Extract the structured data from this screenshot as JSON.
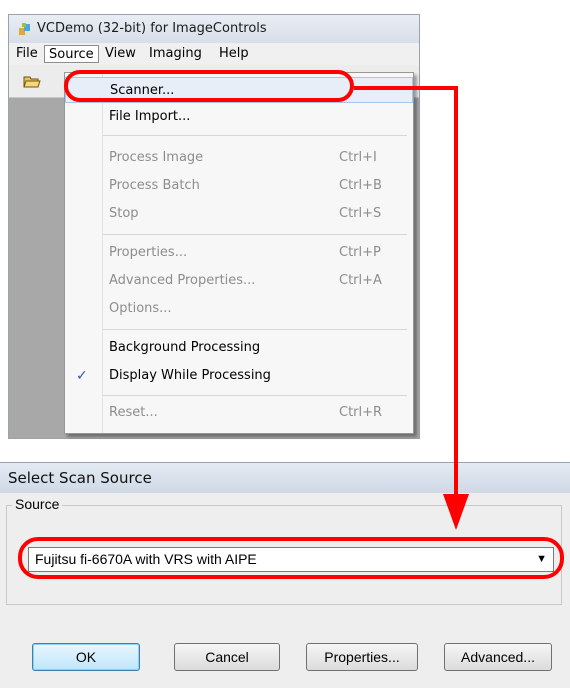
{
  "app": {
    "title": "VCDemo (32-bit) for ImageControls",
    "menus": [
      "File",
      "Source",
      "View",
      "Imaging",
      "Help"
    ]
  },
  "source_menu": {
    "items": [
      {
        "label": "Scanner...",
        "shortcut": "",
        "enabled": true
      },
      {
        "label": "File Import...",
        "shortcut": "",
        "enabled": true
      },
      {
        "label": "Process Image",
        "shortcut": "Ctrl+I",
        "enabled": false
      },
      {
        "label": "Process Batch",
        "shortcut": "Ctrl+B",
        "enabled": false
      },
      {
        "label": "Stop",
        "shortcut": "Ctrl+S",
        "enabled": false
      },
      {
        "label": "Properties...",
        "shortcut": "Ctrl+P",
        "enabled": false
      },
      {
        "label": "Advanced Properties...",
        "shortcut": "Ctrl+A",
        "enabled": false
      },
      {
        "label": "Options...",
        "shortcut": "",
        "enabled": false
      },
      {
        "label": "Background Processing",
        "shortcut": "",
        "enabled": true
      },
      {
        "label": "Display While Processing",
        "shortcut": "",
        "enabled": true,
        "checked": true
      },
      {
        "label": "Reset...",
        "shortcut": "Ctrl+R",
        "enabled": false
      }
    ]
  },
  "dialog": {
    "title": "Select Scan Source",
    "group_label": "Source",
    "selected_source": "Fujitsu fi-6670A with VRS with AIPE",
    "buttons": {
      "ok": "OK",
      "cancel": "Cancel",
      "properties": "Properties...",
      "advanced": "Advanced..."
    }
  },
  "icons": {
    "check": "checkmark-icon",
    "open": "open-folder-icon",
    "app": "app-icon",
    "dropdown": "chevron-down-icon"
  },
  "colors": {
    "annotation": "#ff0000",
    "menu_highlight": "#e7eef8",
    "workspace": "#a8a8a8"
  }
}
